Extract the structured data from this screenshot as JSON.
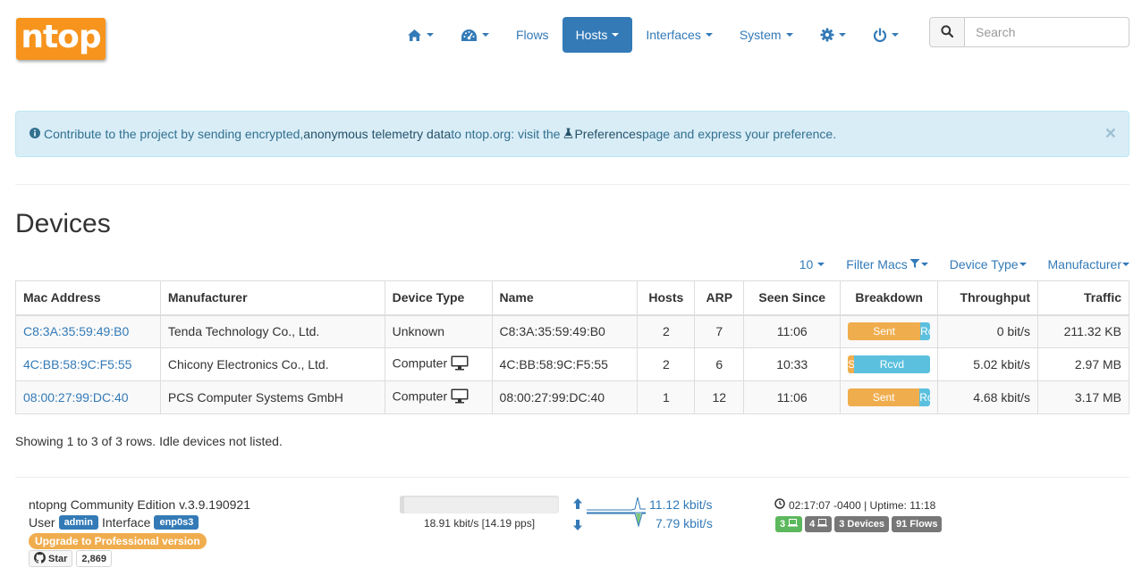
{
  "brand": {
    "logo_text": "ntop",
    "color": "#f7941d"
  },
  "nav": {
    "home_icon": "home-icon",
    "dashboard_icon": "dashboard-icon",
    "flows": "Flows",
    "hosts": "Hosts",
    "interfaces": "Interfaces",
    "system": "System",
    "settings_icon": "gear-icon",
    "power_icon": "power-icon",
    "active_color": "#337ab7"
  },
  "search": {
    "placeholder": "Search"
  },
  "alert": {
    "text_before": "Contribute to the project by sending encrypted, ",
    "link1": "anonymous telemetry data",
    "text_middle": " to ntop.org: visit the ",
    "link2": "Preferences",
    "text_after": " page and express your preference.",
    "close": "×"
  },
  "page": {
    "title": "Devices"
  },
  "toolbar": {
    "page_size": "10",
    "filter_macs": "Filter Macs",
    "device_type": "Device Type",
    "manufacturer": "Manufacturer"
  },
  "table": {
    "headers": [
      "Mac Address",
      "Manufacturer",
      "Device Type",
      "Name",
      "Hosts",
      "ARP",
      "Seen Since",
      "Breakdown",
      "Throughput",
      "Traffic"
    ],
    "rows": [
      {
        "mac": "C8:3A:35:59:49:B0",
        "manufacturer": "Tenda Technology Co., Ltd.",
        "device_type": "Unknown",
        "device_icon": false,
        "name": "C8:3A:35:59:49:B0",
        "hosts": "2",
        "arp": "7",
        "seen_since": "11:06",
        "sent_label": "Sent",
        "rcvd_label": "Rcvd",
        "sent_pct": 88,
        "throughput": "0 bit/s",
        "traffic": "211.32 KB"
      },
      {
        "mac": "4C:BB:58:9C:F5:55",
        "manufacturer": "Chicony Electronics Co., Ltd.",
        "device_type": "Computer",
        "device_icon": true,
        "name": "4C:BB:58:9C:F5:55",
        "hosts": "2",
        "arp": "6",
        "seen_since": "10:33",
        "sent_label": "Sent",
        "rcvd_label": "Rcvd",
        "sent_pct": 7,
        "throughput": "5.02 kbit/s",
        "traffic": "2.97 MB"
      },
      {
        "mac": "08:00:27:99:DC:40",
        "manufacturer": "PCS Computer Systems GmbH",
        "device_type": "Computer",
        "device_icon": true,
        "name": "08:00:27:99:DC:40",
        "hosts": "1",
        "arp": "12",
        "seen_since": "11:06",
        "sent_label": "Sent",
        "rcvd_label": "Rcvd",
        "sent_pct": 87,
        "throughput": "4.68 kbit/s",
        "traffic": "3.17 MB"
      }
    ],
    "sent_color": "#f0ad4e",
    "rcvd_color": "#5bc0de"
  },
  "summary": "Showing 1 to 3 of 3 rows. Idle devices not listed.",
  "footer": {
    "version": "ntopng Community Edition v.3.9.190921",
    "user_label": "User",
    "user": "admin",
    "interface_label": "Interface",
    "interface": "enp0s3",
    "upgrade": "Upgrade to Professional version",
    "github_star": "Star",
    "github_count": "2,869",
    "progress_fill_pct": 3,
    "rate": "18.91 kbit/s [14.19 pps]",
    "tput_up": "11.12 kbit/s",
    "tput_down": "7.79 kbit/s",
    "clock": "02:17:07 -0400 | Uptime: 11:18",
    "badges": {
      "local_hosts": "3",
      "remote_hosts": "4",
      "devices": "3 Devices",
      "flows": "91 Flows"
    }
  }
}
